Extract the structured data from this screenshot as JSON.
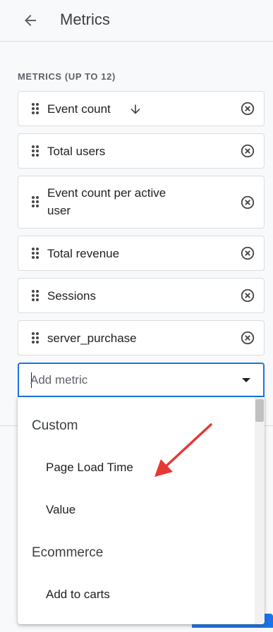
{
  "header": {
    "title": "Metrics",
    "back_icon": "arrow-back-icon"
  },
  "section_label": "METRICS (UP TO 12)",
  "metrics": [
    {
      "label": "Event count",
      "sorted": "descending"
    },
    {
      "label": "Total users"
    },
    {
      "label_line1": "Event count per active",
      "label_line2": "user"
    },
    {
      "label": "Total revenue"
    },
    {
      "label": "Sessions"
    },
    {
      "label": "server_purchase"
    }
  ],
  "add_metric": {
    "placeholder": "Add metric",
    "value": ""
  },
  "dropdown": {
    "groups": [
      {
        "name": "Custom",
        "items": [
          "Page Load Time",
          "Value"
        ]
      },
      {
        "name": "Ecommerce",
        "items": [
          "Add to carts"
        ]
      }
    ]
  },
  "colors": {
    "accent": "#1a73e8",
    "annotation_arrow": "#e53935",
    "text": "#202124",
    "muted": "#5f6368"
  }
}
